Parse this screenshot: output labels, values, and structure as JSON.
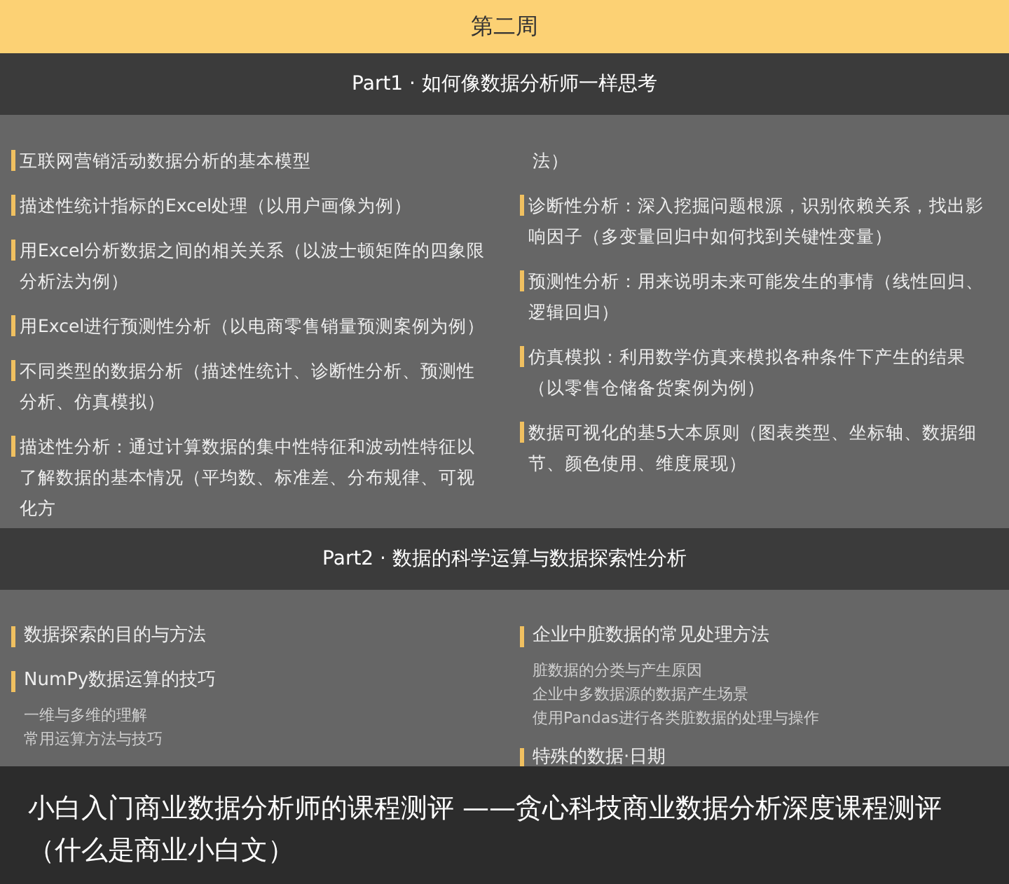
{
  "week_header": {
    "title": "第二周"
  },
  "part1": {
    "title": "Part1 · 如何像数据分析师一样思考",
    "columns": [
      [
        {
          "kind": "topic",
          "text": "互联网营销活动数据分析的基本模型"
        },
        {
          "kind": "topic",
          "text": "描述性统计指标的Excel处理（以用户画像为例）"
        },
        {
          "kind": "topic",
          "text": "用Excel分析数据之间的相关关系（以波士顿矩阵的四象限分析法为例）"
        },
        {
          "kind": "topic",
          "text": "用Excel进行预测性分析（以电商零售销量预测案例为例）"
        },
        {
          "kind": "topic",
          "text": "不同类型的数据分析（描述性统计、诊断性分析、预测性分析、仿真模拟）"
        },
        {
          "kind": "topic",
          "text": "描述性分析：通过计算数据的集中性特征和波动性特征以了解数据的基本情况（平均数、标准差、分布规律、可视化方"
        }
      ],
      [
        {
          "kind": "continuation",
          "text": "法）"
        },
        {
          "kind": "topic",
          "text": "诊断性分析：深入挖掘问题根源，识别依赖关系，找出影响因子（多变量回归中如何找到关键性变量）"
        },
        {
          "kind": "topic",
          "text": "预测性分析：用来说明未来可能发生的事情（线性回归、逻辑回归）"
        },
        {
          "kind": "topic",
          "text": "仿真模拟：利用数学仿真来模拟各种条件下产生的结果（以零售仓储备货案例为例）"
        },
        {
          "kind": "topic",
          "text": "数据可视化的基5大本原则（图表类型、坐标轴、数据细节、颜色使用、维度展现）"
        }
      ]
    ]
  },
  "part2": {
    "title": "Part2 · 数据的科学运算与数据探索性分析",
    "columns": [
      [
        {
          "title": "数据探索的目的与方法"
        },
        {
          "title": "NumPy数据运算的技巧",
          "subtopics": [
            "一维与多维的理解",
            "常用运算方法与技巧"
          ]
        }
      ],
      [
        {
          "title": "企业中脏数据的常见处理方法",
          "subtopics": [
            "脏数据的分类与产生原因",
            "企业中多数据源的数据产生场景",
            "使用Pandas进行各类脏数据的处理与操作"
          ]
        },
        {
          "title": "特殊的数据·日期"
        }
      ]
    ]
  },
  "caption": {
    "text": "小白入门商业数据分析师的课程测评 ——贪心科技商业数据分析深度课程测评（什么是商业小白文）"
  }
}
